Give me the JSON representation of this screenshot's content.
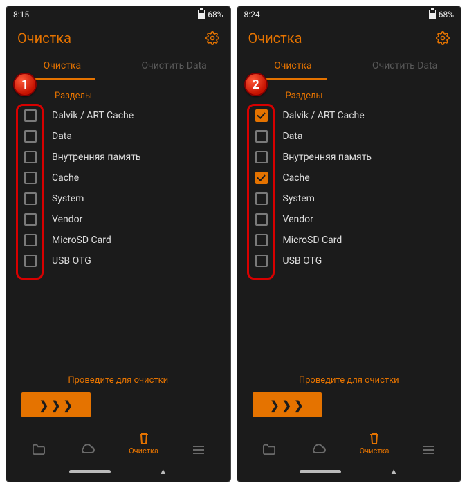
{
  "screens": [
    {
      "time": "8:15",
      "battery": "68%",
      "title": "Очистка",
      "tabs": {
        "active": "Очистка",
        "inactive": "Очистить Data"
      },
      "badge": "1",
      "section": "Разделы",
      "items": [
        {
          "label": "Dalvik / ART Cache",
          "checked": false
        },
        {
          "label": "Data",
          "checked": false
        },
        {
          "label": "Внутренняя память",
          "checked": false
        },
        {
          "label": "Cache",
          "checked": false
        },
        {
          "label": "System",
          "checked": false
        },
        {
          "label": "Vendor",
          "checked": false
        },
        {
          "label": "MicroSD Card",
          "checked": false
        },
        {
          "label": "USB OTG",
          "checked": false
        }
      ],
      "swipe": "Проведите для очистки",
      "nav_active": "Очистка"
    },
    {
      "time": "8:24",
      "battery": "68%",
      "title": "Очистка",
      "tabs": {
        "active": "Очистка",
        "inactive": "Очистить Data"
      },
      "badge": "2",
      "section": "Разделы",
      "items": [
        {
          "label": "Dalvik / ART Cache",
          "checked": true
        },
        {
          "label": "Data",
          "checked": false
        },
        {
          "label": "Внутренняя память",
          "checked": false
        },
        {
          "label": "Cache",
          "checked": true
        },
        {
          "label": "System",
          "checked": false
        },
        {
          "label": "Vendor",
          "checked": false
        },
        {
          "label": "MicroSD Card",
          "checked": false
        },
        {
          "label": "USB OTG",
          "checked": false
        }
      ],
      "swipe": "Проведите для очистки",
      "nav_active": "Очистка"
    }
  ]
}
